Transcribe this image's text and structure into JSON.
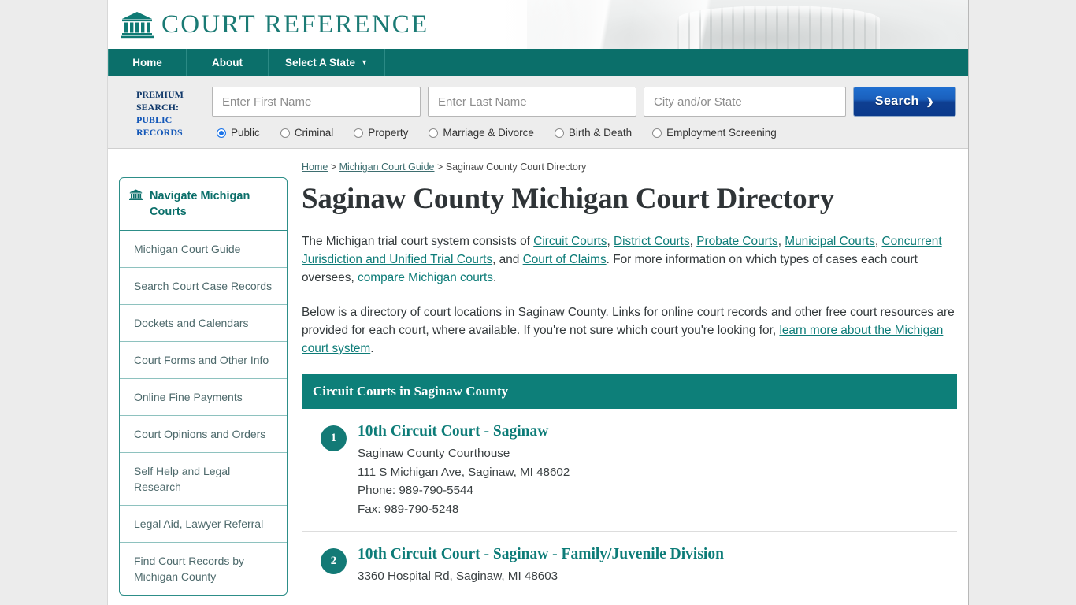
{
  "brand": {
    "title": "COURT REFERENCE",
    "logo_icon": "courthouse-icon"
  },
  "nav": {
    "items": [
      {
        "label": "Home",
        "icon": null
      },
      {
        "label": "About",
        "icon": null
      },
      {
        "label": "Select A State",
        "icon": "chevron-down-icon"
      }
    ]
  },
  "premium_search": {
    "label_line1": "PREMIUM",
    "label_line2": "SEARCH:",
    "label_line3": "PUBLIC",
    "label_line4": "RECORDS",
    "first_name": {
      "placeholder": "Enter First Name",
      "value": ""
    },
    "last_name": {
      "placeholder": "Enter Last Name",
      "value": ""
    },
    "city_state": {
      "placeholder": "City and/or State",
      "value": ""
    },
    "button": {
      "label": "Search",
      "icon": "chevron-right-icon"
    },
    "radios": [
      {
        "label": "Public",
        "selected": true
      },
      {
        "label": "Criminal",
        "selected": false
      },
      {
        "label": "Property",
        "selected": false
      },
      {
        "label": "Marriage & Divorce",
        "selected": false
      },
      {
        "label": "Birth & Death",
        "selected": false
      },
      {
        "label": "Employment Screening",
        "selected": false
      }
    ]
  },
  "sidebar": {
    "heading": "Navigate Michigan Courts",
    "heading_icon": "courthouse-icon",
    "items": [
      {
        "label": "Michigan Court Guide"
      },
      {
        "label": "Search Court Case Records"
      },
      {
        "label": "Dockets and Calendars"
      },
      {
        "label": "Court Forms and Other Info"
      },
      {
        "label": "Online Fine Payments"
      },
      {
        "label": "Court Opinions and Orders"
      },
      {
        "label": "Self Help and Legal Research"
      },
      {
        "label": "Legal Aid, Lawyer Referral"
      },
      {
        "label": "Find Court Records by Michigan County"
      }
    ]
  },
  "breadcrumb": {
    "home": "Home",
    "sep": " > ",
    "guide": "Michigan Court Guide",
    "current": "Saginaw County Court Directory"
  },
  "main": {
    "title": "Saginaw County Michigan Court Directory",
    "paragraph1": {
      "t1": "The Michigan trial court system consists of ",
      "l1": "Circuit Courts",
      "t2": ", ",
      "l2": "District Courts",
      "t3": ", ",
      "l3": "Probate Courts",
      "t4": ", ",
      "l4": "Municipal Courts",
      "t5": ", ",
      "l5": "Concurrent Jurisdiction and Unified Trial Courts",
      "t6": ", and ",
      "l6": "Court of Claims",
      "t7": ". For more information on which types of cases each court oversees, ",
      "l7": "compare Michigan courts",
      "t8": "."
    },
    "paragraph2": {
      "t1": "Below is a directory of court locations in Saginaw County. Links for online court records and other free court resources are provided for each court, where available. If you're not sure which court you're looking for, ",
      "l1": "learn more about the Michigan court system",
      "t2": "."
    },
    "section_heading": "Circuit Courts in Saginaw County",
    "courts": [
      {
        "number": "1",
        "name": "10th Circuit Court - Saginaw",
        "lines": [
          "Saginaw County Courthouse",
          "111 S Michigan Ave, Saginaw, MI 48602",
          "Phone: 989-790-5544",
          "Fax: 989-790-5248"
        ]
      },
      {
        "number": "2",
        "name": "10th Circuit Court - Saginaw - Family/Juvenile Division",
        "lines": [
          "3360 Hospital Rd, Saginaw, MI 48603"
        ]
      }
    ]
  },
  "colors": {
    "teal": "#0b6f6a",
    "teal_link": "#0d7c78",
    "section_bg": "#0d7f79",
    "button_blue": "#0f3f91",
    "page_bg": "#ececec",
    "premium_navy": "#123a6b"
  }
}
